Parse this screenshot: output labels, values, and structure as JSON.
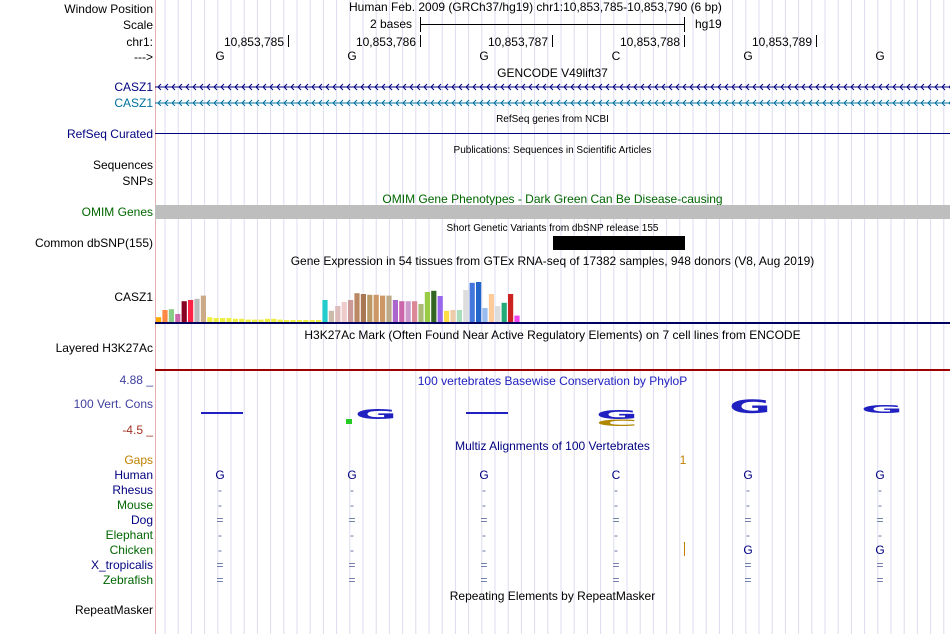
{
  "labels": {
    "window_position": "Window Position",
    "scale": "Scale",
    "chr": "chr1:",
    "arrow": "--->",
    "casz1_a": "CASZ1",
    "casz1_b": "CASZ1",
    "refseq": "RefSeq Curated",
    "sequences": "Sequences",
    "snps": "SNPs",
    "omim": "OMIM Genes",
    "common_dbsnp": "Common dbSNP(155)",
    "casz1_gtex": "CASZ1",
    "h3k27ac": "Layered H3K27Ac",
    "cons_max": "4.88 _",
    "cons": "100 Vert. Cons",
    "cons_min": "-4.5 _",
    "gaps": "Gaps",
    "species": [
      "Human",
      "Rhesus",
      "Mouse",
      "Dog",
      "Elephant",
      "Chicken",
      "X_tropicalis",
      "Zebrafish"
    ],
    "repeatmasker": "RepeatMasker"
  },
  "header": {
    "position_text": "Human Feb. 2009 (GRCh37/hg19)   chr1:10,853,785-10,853,790 (6 bp)",
    "scale_text": "2 bases",
    "assembly": "hg19",
    "coords": [
      "10,853,785",
      "10,853,786",
      "10,853,787",
      "10,853,788",
      "10,853,789"
    ],
    "bases": [
      "G",
      "G",
      "G",
      "C",
      "G",
      "G"
    ]
  },
  "track_titles": {
    "gencode": "GENCODE V49lift37",
    "refseq": "RefSeq genes from NCBI",
    "publications": "Publications: Sequences in Scientific Articles",
    "omim": "OMIM Gene Phenotypes - Dark Green Can Be Disease-causing",
    "dbsnp": "Short Genetic Variants from dbSNP release 155",
    "gtex": "Gene Expression in 54 tissues from GTEx RNA-seq of 17382 samples, 948 donors (V8, Aug 2019)",
    "h3k27ac": "H3K27Ac Mark (Often Found Near Active Regulatory Elements) on 7 cell lines from ENCODE",
    "phylop": "100 vertebrates Basewise Conservation by PhyloP",
    "multiz": "Multiz Alignments of 100 Vertebrates",
    "repeatmasker": "Repeating Elements by RepeatMasker"
  },
  "gaps_value": "1",
  "alignment": [
    [
      "G",
      "G",
      "G",
      "C",
      "G",
      "G"
    ],
    [
      "-",
      "-",
      "-",
      "-",
      "-",
      "-"
    ],
    [
      "-",
      "-",
      "-",
      "-",
      "-",
      "-"
    ],
    [
      "=",
      "=",
      "=",
      "=",
      "=",
      "="
    ],
    [
      "-",
      "-",
      "-",
      "-",
      "-",
      "-"
    ],
    [
      "-",
      "-",
      "-",
      "-",
      "G",
      "G"
    ],
    [
      "=",
      "=",
      "=",
      "=",
      "=",
      "="
    ],
    [
      "=",
      "=",
      "=",
      "=",
      "=",
      "="
    ]
  ],
  "gtex_levels": [
    0.12,
    0.3,
    0.32,
    0.2,
    0.52,
    0.55,
    0.58,
    0.66,
    0.12,
    0.1,
    0.1,
    0.1,
    0.08,
    0.08,
    0.06,
    0.06,
    0.06,
    0.08,
    0.08,
    0.06,
    0.04,
    0.04,
    0.04,
    0.04,
    0.04,
    0.04,
    0.55,
    0.28,
    0.4,
    0.5,
    0.55,
    0.72,
    0.7,
    0.68,
    0.68,
    0.66,
    0.66,
    0.55,
    0.52,
    0.52,
    0.52,
    0.45,
    0.75,
    0.78,
    0.65,
    0.28,
    0.3,
    0.3,
    0.8,
    0.98,
    1.0,
    0.35,
    0.7,
    0.4,
    0.48,
    0.7,
    0.16
  ],
  "gtex_colors": [
    "#ffaa00",
    "#ff8844",
    "#88cc88",
    "#cc66aa",
    "#880022",
    "#ff2244",
    "#bbbbbb",
    "#ccaa88",
    "#eeee44",
    "#eeee44",
    "#eeee44",
    "#eeee44",
    "#eeee44",
    "#eeee44",
    "#eeee44",
    "#eeee44",
    "#eeee44",
    "#eeee44",
    "#eeee44",
    "#eeee44",
    "#eeee44",
    "#eeee44",
    "#eeee44",
    "#eeee44",
    "#eeee44",
    "#eeee44",
    "#22cccc",
    "#ccbbaa",
    "#ddbbbb",
    "#eecccc",
    "#cc9999",
    "#bb8866",
    "#aa7755",
    "#bb9966",
    "#cc9966",
    "#cc9966",
    "#bbaa88",
    "#aa66cc",
    "#cc66aa",
    "#cc99cc",
    "#dd8899",
    "#aabb77",
    "#99cc44",
    "#336622",
    "#9966ee",
    "#ffdd44",
    "#eeccaa",
    "#aaddbb",
    "#dddddd",
    "#4477dd",
    "#2266cc",
    "#99bbee",
    "#ffcc99",
    "#dddddd",
    "#22aa77",
    "#cc2222",
    "#ee44ee"
  ],
  "colors": {
    "navy": "#000080",
    "teal": "#0070a0",
    "omim_green": "#006600",
    "gtex_line": "#000060",
    "h3k27ac_line": "#a00000",
    "phylop_blue": "#2020c0",
    "gaps_orange": "#c08000",
    "cons_min": "#a03020",
    "cons_label": "#4040a0"
  }
}
